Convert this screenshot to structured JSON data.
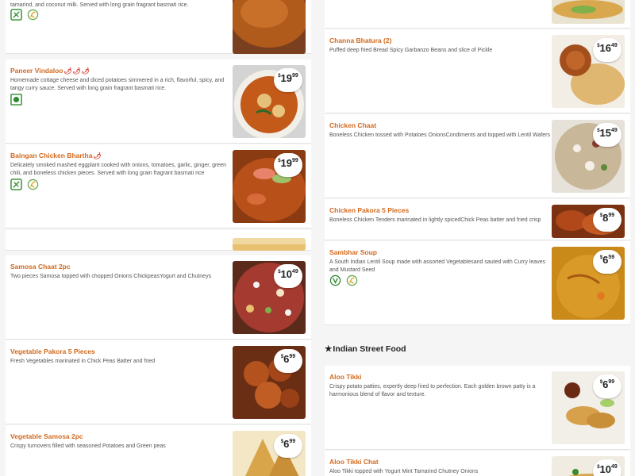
{
  "left_column": {
    "items": [
      {
        "title": "",
        "desc": "tamarind, and coconut milk. Served with long grain fragrant basmati rice.",
        "price_dollars": "",
        "price_cents": ""
      },
      {
        "title": "Paneer Vindaloo",
        "desc": "Homemade cottage cheese and diced potatoes simmered in a rich, flavorful, spicy, and tangy curry sauce. Served with long grain fragrant basmati rice.",
        "price_dollars": "19",
        "price_cents": "99"
      },
      {
        "title": "Baingan Chicken Bhartha",
        "desc": "Delicately smoked mashed eggplant cooked with onions, tomatoes, garlic, ginger, green chili, and boneless chicken pieces. Served with long grain fragrant basmati rice",
        "price_dollars": "19",
        "price_cents": "99"
      },
      {
        "title": "Samosa Chaat 2pc",
        "desc": "Two pieces Samosa topped with chopped Onions ChickpeasYogurt and Chutneys",
        "price_dollars": "10",
        "price_cents": "49"
      },
      {
        "title": "Vegetable Pakora 5 Pieces",
        "desc": "Fresh Vegetables marinated in Chick Peas Batter and fried",
        "price_dollars": "6",
        "price_cents": "99"
      },
      {
        "title": "Vegetable Samosa 2pc",
        "desc": "Crispy turnovers filled with seasoned Potatoes and Green peas",
        "price_dollars": "6",
        "price_cents": "99"
      }
    ]
  },
  "right_column": {
    "items": [
      {
        "title": "Channa Bhatura (2)",
        "desc": "Puffed deep fried Bread Spicy Garbanzo Beans and slice of Pickle",
        "price_dollars": "16",
        "price_cents": "49"
      },
      {
        "title": "Chicken Chaat",
        "desc": "Boneless Chicken tossed with Potatoes OnionsCondiments and topped with Lentil Wafers",
        "price_dollars": "15",
        "price_cents": "49"
      },
      {
        "title": "Chicken Pakora 5 Pieces",
        "desc": "Boneless Chicken Tenders marinated in lightly spicedChick Peas batter and fried crisp",
        "price_dollars": "8",
        "price_cents": "99"
      },
      {
        "title": "Sambhar Soup",
        "desc": "A South Indian Lentil Soup made with assorted Vegetablesand sauted with Curry leaves and Mustard Seed",
        "price_dollars": "6",
        "price_cents": "59"
      }
    ],
    "section_title": "Indian Street Food",
    "street_items": [
      {
        "title": "Aloo Tikki",
        "desc": "Crispy potato patties, expertly deep fried to perfection. Each golden brown patty is a harmonious blend of flavor and texture.",
        "price_dollars": "6",
        "price_cents": "99"
      },
      {
        "title": "Aloo Tikki Chat",
        "desc": "Aloo Tikki topped with Yogurt Mint Tamarind Chutney Onions",
        "price_dollars": "10",
        "price_cents": "49"
      }
    ]
  },
  "currency_symbol": "$",
  "chili_glyph": "🌶",
  "colors": {
    "title": "#d2691e",
    "veg_green": "#2e8b2e",
    "accent": "#e0a020"
  }
}
